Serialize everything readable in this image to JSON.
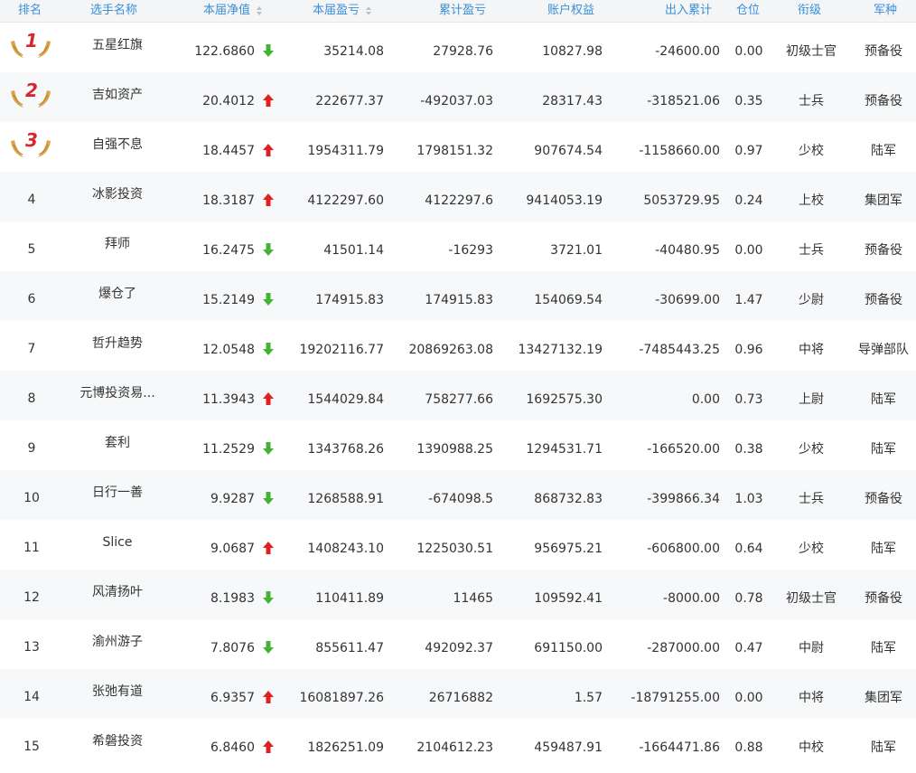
{
  "header": {
    "rank": "排名",
    "player": "选手名称",
    "nav": "本届净值",
    "profit": "本届盈亏",
    "cum_profit": "累计盈亏",
    "equity": "账户权益",
    "flow": "出入累计",
    "position": "仓位",
    "title": "衔级",
    "army": "军种"
  },
  "colors": {
    "header_text": "#3b8fd6",
    "header_bg": "#f3f5f7",
    "up_arrow": "#e02020",
    "down_arrow": "#44b335",
    "medal_gold": "#d9a44a",
    "medal_red": "#d8262e"
  },
  "rows": [
    {
      "rank": "1",
      "medal": true,
      "name": "五星红旗",
      "nav": "122.6860",
      "trend": "down",
      "profit": "35214.08",
      "cum_profit": "27928.76",
      "equity": "10827.98",
      "flow": "-24600.00",
      "position": "0.00",
      "title": "初级士官",
      "army": "预备役"
    },
    {
      "rank": "2",
      "medal": true,
      "name": "吉如资产",
      "nav": "20.4012",
      "trend": "up",
      "profit": "222677.37",
      "cum_profit": "-492037.03",
      "equity": "28317.43",
      "flow": "-318521.06",
      "position": "0.35",
      "title": "士兵",
      "army": "预备役"
    },
    {
      "rank": "3",
      "medal": true,
      "name": "自强不息",
      "nav": "18.4457",
      "trend": "up",
      "profit": "1954311.79",
      "cum_profit": "1798151.32",
      "equity": "907674.54",
      "flow": "-1158660.00",
      "position": "0.97",
      "title": "少校",
      "army": "陆军"
    },
    {
      "rank": "4",
      "medal": false,
      "name": "冰影投资",
      "nav": "18.3187",
      "trend": "up",
      "profit": "4122297.60",
      "cum_profit": "4122297.6",
      "equity": "9414053.19",
      "flow": "5053729.95",
      "position": "0.24",
      "title": "上校",
      "army": "集团军"
    },
    {
      "rank": "5",
      "medal": false,
      "name": "拜师",
      "nav": "16.2475",
      "trend": "down",
      "profit": "41501.14",
      "cum_profit": "-16293",
      "equity": "3721.01",
      "flow": "-40480.95",
      "position": "0.00",
      "title": "士兵",
      "army": "预备役"
    },
    {
      "rank": "6",
      "medal": false,
      "name": "爆仓了",
      "nav": "15.2149",
      "trend": "down",
      "profit": "174915.83",
      "cum_profit": "174915.83",
      "equity": "154069.54",
      "flow": "-30699.00",
      "position": "1.47",
      "title": "少尉",
      "army": "预备役"
    },
    {
      "rank": "7",
      "medal": false,
      "name": "哲升趋势",
      "nav": "12.0548",
      "trend": "down",
      "profit": "19202116.77",
      "cum_profit": "20869263.08",
      "equity": "13427132.19",
      "flow": "-7485443.25",
      "position": "0.96",
      "title": "中将",
      "army": "导弹部队"
    },
    {
      "rank": "8",
      "medal": false,
      "name": "元博投资易...",
      "nav": "11.3943",
      "trend": "up",
      "profit": "1544029.84",
      "cum_profit": "758277.66",
      "equity": "1692575.30",
      "flow": "0.00",
      "position": "0.73",
      "title": "上尉",
      "army": "陆军"
    },
    {
      "rank": "9",
      "medal": false,
      "name": "套利",
      "nav": "11.2529",
      "trend": "down",
      "profit": "1343768.26",
      "cum_profit": "1390988.25",
      "equity": "1294531.71",
      "flow": "-166520.00",
      "position": "0.38",
      "title": "少校",
      "army": "陆军"
    },
    {
      "rank": "10",
      "medal": false,
      "name": "日行一善",
      "nav": "9.9287",
      "trend": "down",
      "profit": "1268588.91",
      "cum_profit": "-674098.5",
      "equity": "868732.83",
      "flow": "-399866.34",
      "position": "1.03",
      "title": "士兵",
      "army": "预备役"
    },
    {
      "rank": "11",
      "medal": false,
      "name": "Slice",
      "nav": "9.0687",
      "trend": "up",
      "profit": "1408243.10",
      "cum_profit": "1225030.51",
      "equity": "956975.21",
      "flow": "-606800.00",
      "position": "0.64",
      "title": "少校",
      "army": "陆军"
    },
    {
      "rank": "12",
      "medal": false,
      "name": "风清扬叶",
      "nav": "8.1983",
      "trend": "down",
      "profit": "110411.89",
      "cum_profit": "11465",
      "equity": "109592.41",
      "flow": "-8000.00",
      "position": "0.78",
      "title": "初级士官",
      "army": "预备役"
    },
    {
      "rank": "13",
      "medal": false,
      "name": "渝州游子",
      "nav": "7.8076",
      "trend": "down",
      "profit": "855611.47",
      "cum_profit": "492092.37",
      "equity": "691150.00",
      "flow": "-287000.00",
      "position": "0.47",
      "title": "中尉",
      "army": "陆军"
    },
    {
      "rank": "14",
      "medal": false,
      "name": "张弛有道",
      "nav": "6.9357",
      "trend": "up",
      "profit": "16081897.26",
      "cum_profit": "26716882",
      "equity": "1.57",
      "flow": "-18791255.00",
      "position": "0.00",
      "title": "中将",
      "army": "集团军"
    },
    {
      "rank": "15",
      "medal": false,
      "name": "希磐投资",
      "nav": "6.8460",
      "trend": "up",
      "profit": "1826251.09",
      "cum_profit": "2104612.23",
      "equity": "459487.91",
      "flow": "-1664471.86",
      "position": "0.88",
      "title": "中校",
      "army": "陆军"
    }
  ]
}
